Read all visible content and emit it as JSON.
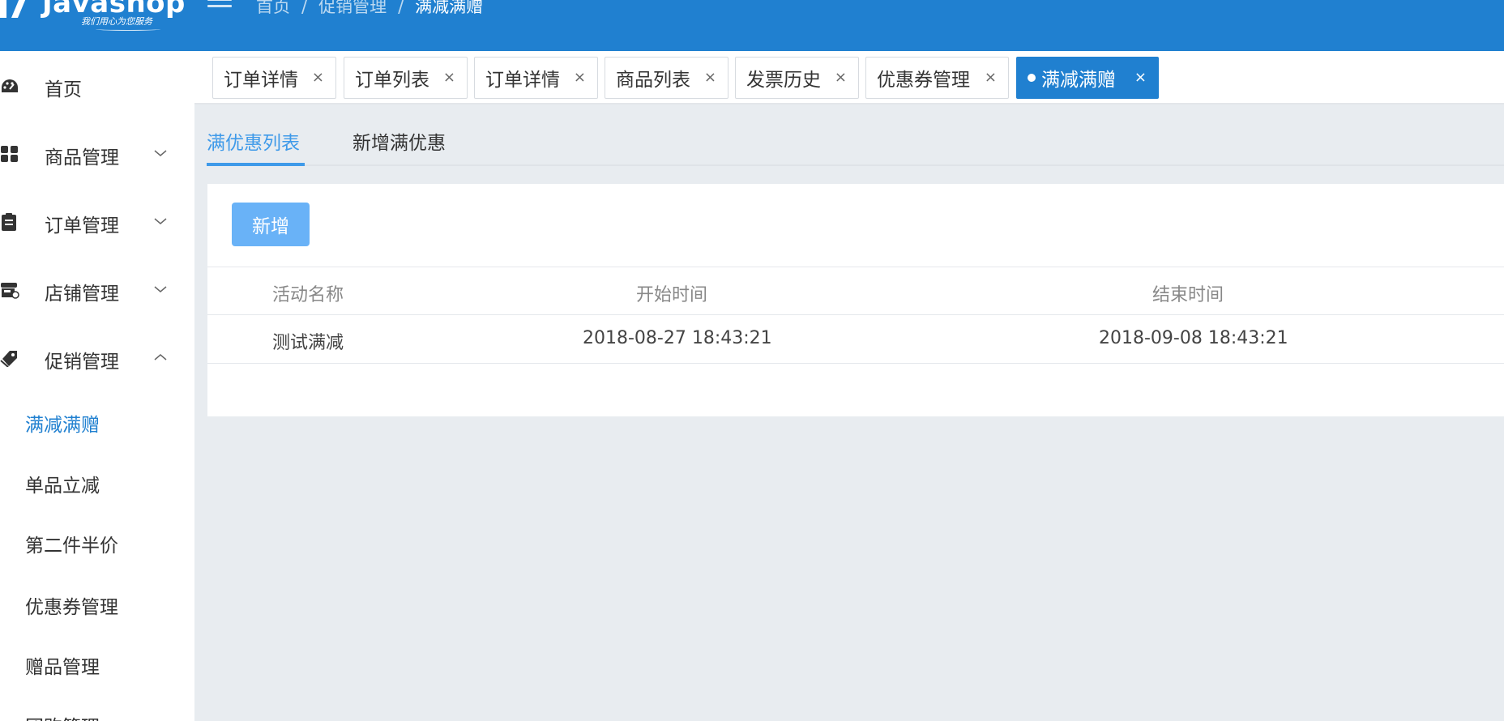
{
  "header": {
    "logo_text": "Javashop",
    "logo_slogan": "我们用心为您服务",
    "breadcrumb": [
      "首页",
      "促销管理",
      "满减满赠"
    ],
    "breadcrumb_sep": "/"
  },
  "sidebar": {
    "items": [
      {
        "label": "首页",
        "icon": "dashboard-icon",
        "has_children": false
      },
      {
        "label": "商品管理",
        "icon": "grid-icon",
        "has_children": true,
        "expanded": false
      },
      {
        "label": "订单管理",
        "icon": "clipboard-icon",
        "has_children": true,
        "expanded": false
      },
      {
        "label": "店铺管理",
        "icon": "shop-icon",
        "has_children": true,
        "expanded": false
      },
      {
        "label": "促销管理",
        "icon": "tag-icon",
        "has_children": true,
        "expanded": true
      }
    ],
    "promotion_children": [
      "满减满赠",
      "单品立减",
      "第二件半价",
      "优惠券管理",
      "赠品管理",
      "团购管理"
    ],
    "active_child": "满减满赠"
  },
  "tabs": [
    {
      "label": "订单详情",
      "active": false
    },
    {
      "label": "订单列表",
      "active": false
    },
    {
      "label": "订单详情",
      "active": false
    },
    {
      "label": "商品列表",
      "active": false
    },
    {
      "label": "发票历史",
      "active": false
    },
    {
      "label": "优惠券管理",
      "active": false
    },
    {
      "label": "满减满赠",
      "active": true
    }
  ],
  "tab_close": "×",
  "subtabs": [
    {
      "label": "满优惠列表",
      "active": true
    },
    {
      "label": "新增满优惠",
      "active": false
    }
  ],
  "panel": {
    "add_button": "新增",
    "columns": [
      "活动名称",
      "开始时间",
      "结束时间"
    ],
    "rows": [
      [
        "测试满减",
        "2018-08-27 18:43:21",
        "2018-09-08 18:43:21"
      ]
    ]
  },
  "colors": {
    "brand": "#2080d0",
    "active_text": "#3f9ae9",
    "button": "#69b2f7"
  }
}
